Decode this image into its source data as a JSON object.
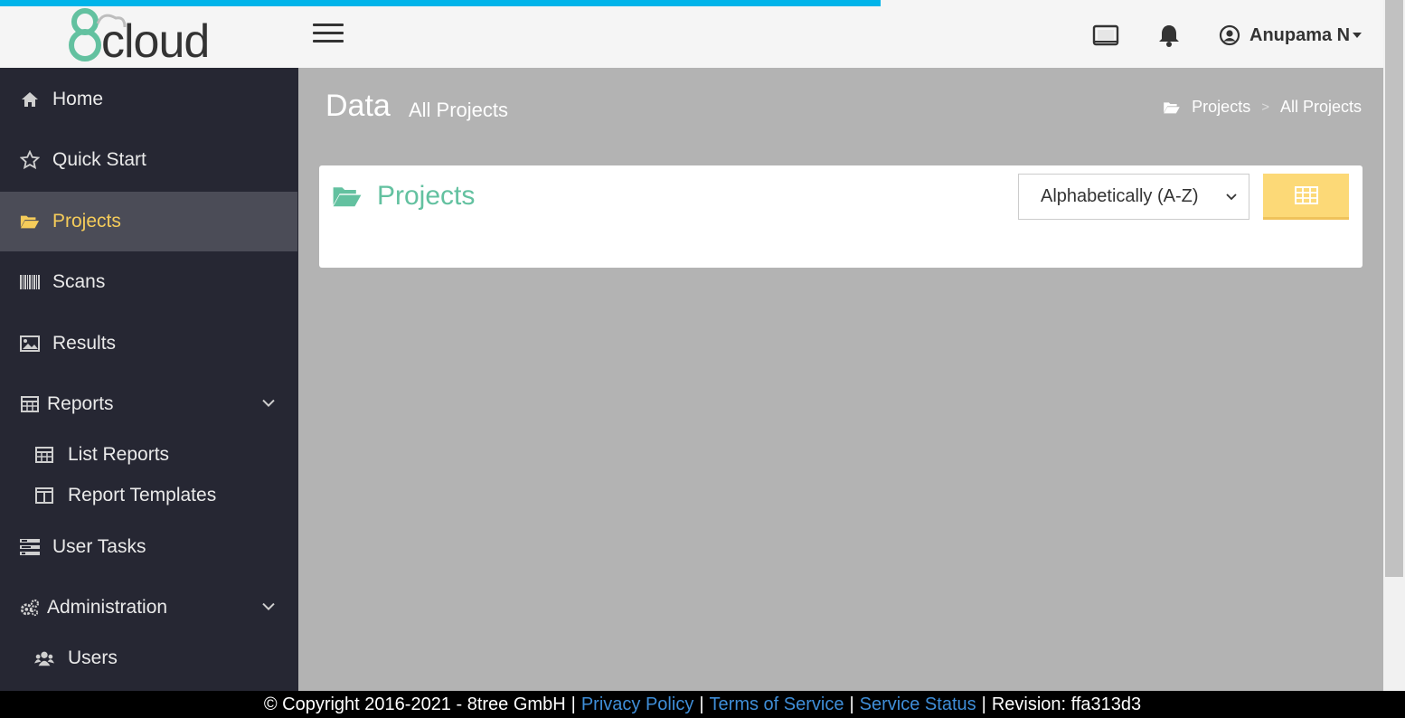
{
  "header": {
    "logo_digit": "8",
    "logo_text": "cloud",
    "user_name": "Anupama N"
  },
  "sidebar": {
    "items": [
      {
        "label": "Home"
      },
      {
        "label": "Quick Start"
      },
      {
        "label": "Projects"
      },
      {
        "label": "Scans"
      },
      {
        "label": "Results"
      },
      {
        "label": "Reports"
      },
      {
        "label": "List Reports"
      },
      {
        "label": "Report Templates"
      },
      {
        "label": "User Tasks"
      },
      {
        "label": "Administration"
      },
      {
        "label": "Users"
      }
    ]
  },
  "page": {
    "title": "Data",
    "subtitle": "All Projects",
    "breadcrumb": [
      "Projects",
      ">",
      "All Projects"
    ]
  },
  "panel": {
    "title": "Projects",
    "sort_selected": "Alphabetically (A-Z)"
  },
  "footer": {
    "copyright": "© Copyright 2016-2021 - 8tree GmbH",
    "privacy": "Privacy Policy",
    "terms": "Terms of Service",
    "status": "Service Status",
    "revision": "Revision: ffa313d3",
    "separator": "|"
  },
  "colors": {
    "accent_blue": "#00b4ea",
    "sidebar_bg": "#262733",
    "active_text": "#f5cc5a",
    "panel_title": "#63c1a0",
    "grid_button": "#fcd977"
  },
  "icons": {
    "home": "home-icon",
    "quick_start": "star-icon",
    "projects": "folder-open-icon",
    "scans": "barcode-icon",
    "results": "image-icon",
    "reports": "table-icon",
    "list_reports": "table-icon",
    "report_templates": "columns-icon",
    "user_tasks": "tasks-icon",
    "administration": "gears-icon",
    "users": "users-icon"
  }
}
